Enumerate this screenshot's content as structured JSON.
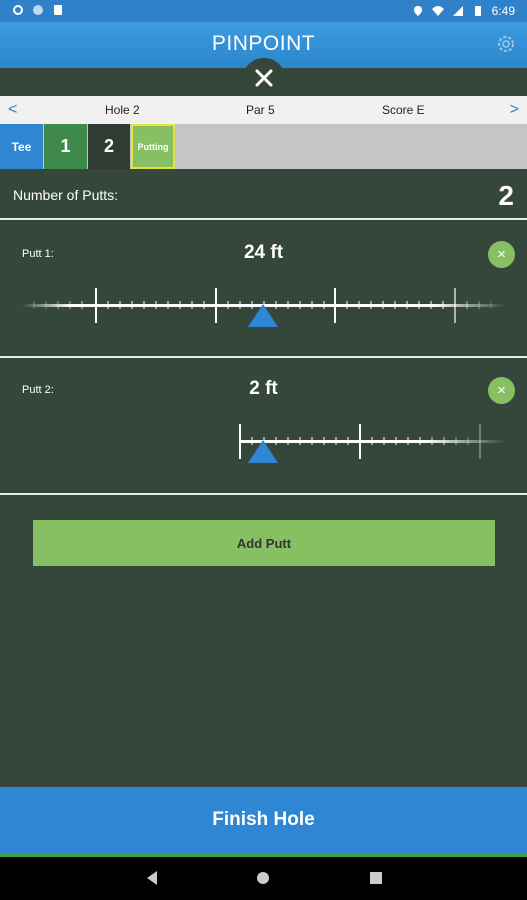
{
  "status_bar": {
    "time": "6:49"
  },
  "app": {
    "logo_text": "PINPOINT"
  },
  "hole_bar": {
    "hole": "Hole 2",
    "par": "Par 5",
    "score": "Score E",
    "prev": "<",
    "next": ">"
  },
  "shots": [
    {
      "label": "Tee",
      "color": "#2f86d3"
    },
    {
      "label": "1",
      "color": "#3d8a4a"
    },
    {
      "label": "2",
      "color": "#2f3b33"
    },
    {
      "label": "Putting",
      "color": "#86c062"
    }
  ],
  "putts_section": {
    "label": "Number of Putts:",
    "count": "2"
  },
  "putts": [
    {
      "label": "Putt 1:",
      "distance": "24 ft",
      "remove": "×"
    },
    {
      "label": "Putt 2:",
      "distance": "2 ft",
      "remove": "×"
    }
  ],
  "add_putt_label": "Add Putt",
  "finish_label": "Finish Hole",
  "colors": {
    "accent_blue": "#2f86d3",
    "accent_green": "#86c062",
    "background": "#35473b"
  }
}
